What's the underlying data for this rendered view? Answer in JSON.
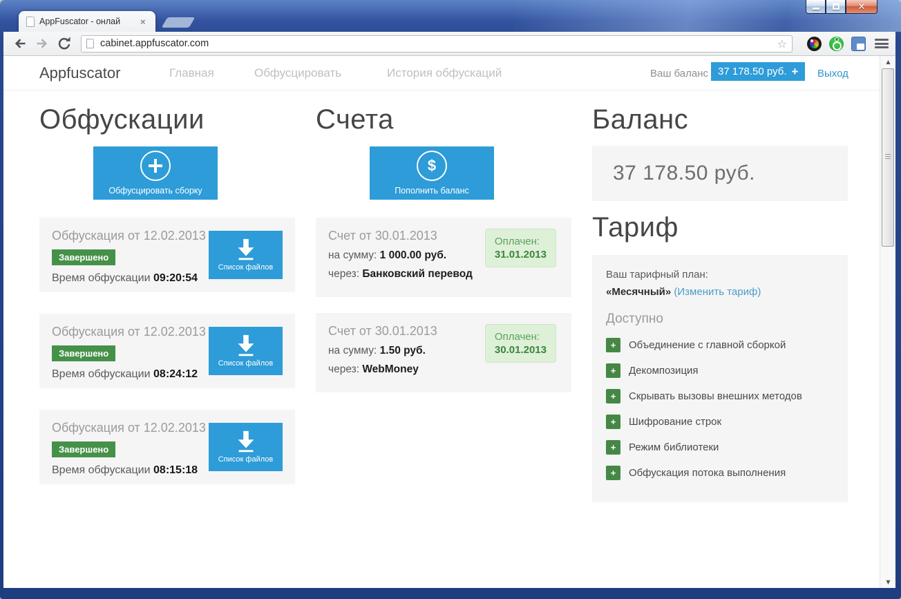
{
  "window": {
    "tab_title": "AppFuscator - онлай",
    "tab_close": "×",
    "url": "cabinet.appfuscator.com",
    "star": "☆",
    "scroll_up": "▲",
    "scroll_down": "▼"
  },
  "header": {
    "brand": "Appfuscator",
    "nav": [
      {
        "label": "Главная"
      },
      {
        "label": "Обфусцировать"
      },
      {
        "label": "История обфускаций"
      }
    ],
    "balance_label": "Ваш баланс",
    "balance_value": "37 178.50 руб.",
    "balance_plus": "+",
    "logout": "Выход"
  },
  "obfuscations": {
    "title": "Обфускации",
    "new_button_label": "Обфусцировать сборку",
    "items": [
      {
        "title": "Обфускация от 12.02.2013",
        "status": "Завершено",
        "time_label": "Время обфускации",
        "time": "09:20:54",
        "files_label": "Список файлов"
      },
      {
        "title": "Обфускация от 12.02.2013",
        "status": "Завершено",
        "time_label": "Время обфускации",
        "time": "08:24:12",
        "files_label": "Список файлов"
      },
      {
        "title": "Обфускация от 12.02.2013",
        "status": "Завершено",
        "time_label": "Время обфускации",
        "time": "08:15:18",
        "files_label": "Список файлов"
      }
    ]
  },
  "invoices": {
    "title": "Счета",
    "topup_button_label": "Пополнить баланс",
    "dollar_glyph": "$",
    "items": [
      {
        "title": "Счет от 30.01.2013",
        "amount_label": "на сумму:",
        "amount": "1 000.00 руб.",
        "via_label": "через:",
        "via": "Банковский перевод",
        "paid_label": "Оплачен:",
        "paid_date": "31.01.2013"
      },
      {
        "title": "Счет от 30.01.2013",
        "amount_label": "на сумму:",
        "amount": "1.50 руб.",
        "via_label": "через:",
        "via": "WebMoney",
        "paid_label": "Оплачен:",
        "paid_date": "30.01.2013"
      }
    ]
  },
  "balance": {
    "title": "Баланс",
    "amount": "37 178.50 руб."
  },
  "tariff": {
    "title": "Тариф",
    "plan_label": "Ваш тарифный план:",
    "plan_name": "«Месячный»",
    "change_link": "(Изменить тариф)",
    "available_label": "Доступно",
    "plus_glyph": "+",
    "features": [
      "Объединение с главной сборкой",
      "Декомпозиция",
      "Скрывать вызовы внешних методов",
      "Шифрование строк",
      "Режим библиотеки",
      "Обфускация потока выполнения"
    ]
  },
  "colors": {
    "accent_blue": "#2d9cd8",
    "status_green": "#46914a",
    "feature_green": "#458845",
    "paid_badge_bg": "#def0d8",
    "paid_badge_text": "#3a853a",
    "link_blue": "#4a9cc9",
    "card_bg": "#f5f5f5"
  }
}
